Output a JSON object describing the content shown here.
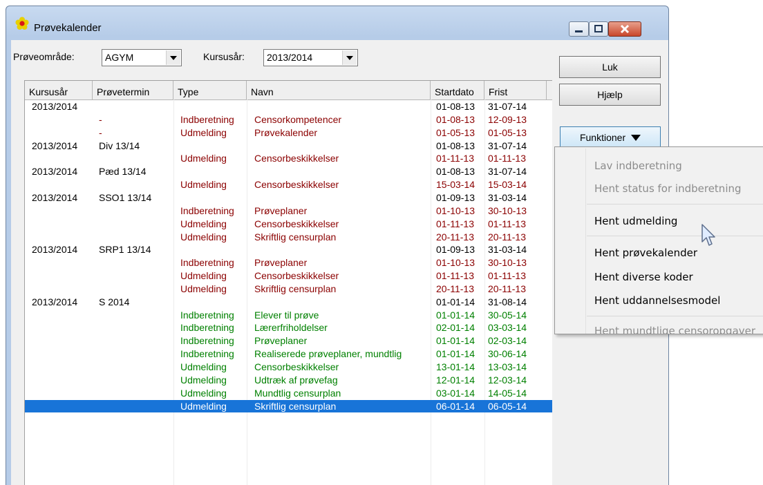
{
  "window": {
    "title": "Prøvekalender"
  },
  "filters": {
    "area_label": "Prøveområde:",
    "area_value": "AGYM",
    "year_label": "Kursusår:",
    "year_value": "2013/2014"
  },
  "buttons": {
    "close": "Luk",
    "help": "Hjælp",
    "functions": "Funktioner"
  },
  "columns": [
    "Kursusår",
    "Prøvetermin",
    "Type",
    "Navn",
    "Startdato",
    "Frist"
  ],
  "rows": [
    {
      "year": "2013/2014",
      "term": "",
      "type": "",
      "name": "",
      "start": "01-08-13",
      "frist": "31-07-14",
      "color": "#000000"
    },
    {
      "year": "",
      "term": "-",
      "type": "Indberetning",
      "name": "Censorkompetencer",
      "start": "01-08-13",
      "frist": "12-09-13",
      "color": "#8b0000"
    },
    {
      "year": "",
      "term": "-",
      "type": "Udmelding",
      "name": "Prøvekalender",
      "start": "01-05-13",
      "frist": "01-05-13",
      "color": "#8b0000"
    },
    {
      "year": "2013/2014",
      "term": "Div 13/14",
      "type": "",
      "name": "",
      "start": "01-08-13",
      "frist": "31-07-14",
      "color": "#000000"
    },
    {
      "year": "",
      "term": "",
      "type": "Udmelding",
      "name": "Censorbeskikkelser",
      "start": "01-11-13",
      "frist": "01-11-13",
      "color": "#8b0000"
    },
    {
      "year": "2013/2014",
      "term": "Pæd 13/14",
      "type": "",
      "name": "",
      "start": "01-08-13",
      "frist": "31-07-14",
      "color": "#000000"
    },
    {
      "year": "",
      "term": "",
      "type": "Udmelding",
      "name": "Censorbeskikkelser",
      "start": "15-03-14",
      "frist": "15-03-14",
      "color": "#8b0000"
    },
    {
      "year": "2013/2014",
      "term": "SSO1 13/14",
      "type": "",
      "name": "",
      "start": "01-09-13",
      "frist": "31-03-14",
      "color": "#000000"
    },
    {
      "year": "",
      "term": "",
      "type": "Indberetning",
      "name": "Prøveplaner",
      "start": "01-10-13",
      "frist": "30-10-13",
      "color": "#8b0000"
    },
    {
      "year": "",
      "term": "",
      "type": "Udmelding",
      "name": "Censorbeskikkelser",
      "start": "01-11-13",
      "frist": "01-11-13",
      "color": "#8b0000"
    },
    {
      "year": "",
      "term": "",
      "type": "Udmelding",
      "name": "Skriftlig censurplan",
      "start": "20-11-13",
      "frist": "20-11-13",
      "color": "#8b0000"
    },
    {
      "year": "2013/2014",
      "term": "SRP1 13/14",
      "type": "",
      "name": "",
      "start": "01-09-13",
      "frist": "31-03-14",
      "color": "#000000"
    },
    {
      "year": "",
      "term": "",
      "type": "Indberetning",
      "name": "Prøveplaner",
      "start": "01-10-13",
      "frist": "30-10-13",
      "color": "#8b0000"
    },
    {
      "year": "",
      "term": "",
      "type": "Udmelding",
      "name": "Censorbeskikkelser",
      "start": "01-11-13",
      "frist": "01-11-13",
      "color": "#8b0000"
    },
    {
      "year": "",
      "term": "",
      "type": "Udmelding",
      "name": "Skriftlig censurplan",
      "start": "20-11-13",
      "frist": "20-11-13",
      "color": "#8b0000"
    },
    {
      "year": "2013/2014",
      "term": "S 2014",
      "type": "",
      "name": "",
      "start": "01-01-14",
      "frist": "31-08-14",
      "color": "#000000"
    },
    {
      "year": "",
      "term": "",
      "type": "Indberetning",
      "name": "Elever til prøve",
      "start": "01-01-14",
      "frist": "30-05-14",
      "color": "#008000"
    },
    {
      "year": "",
      "term": "",
      "type": "Indberetning",
      "name": "Lærerfriholdelser",
      "start": "02-01-14",
      "frist": "03-03-14",
      "color": "#008000"
    },
    {
      "year": "",
      "term": "",
      "type": "Indberetning",
      "name": "Prøveplaner",
      "start": "01-01-14",
      "frist": "02-03-14",
      "color": "#008000"
    },
    {
      "year": "",
      "term": "",
      "type": "Indberetning",
      "name": "Realiserede prøveplaner, mundtlig",
      "start": "01-01-14",
      "frist": "30-06-14",
      "color": "#008000"
    },
    {
      "year": "",
      "term": "",
      "type": "Udmelding",
      "name": "Censorbeskikkelser",
      "start": "13-01-14",
      "frist": "13-03-14",
      "color": "#008000"
    },
    {
      "year": "",
      "term": "",
      "type": "Udmelding",
      "name": "Udtræk af prøvefag",
      "start": "12-01-14",
      "frist": "12-03-14",
      "color": "#008000"
    },
    {
      "year": "",
      "term": "",
      "type": "Udmelding",
      "name": "Mundtlig censurplan",
      "start": "03-01-14",
      "frist": "14-05-14",
      "color": "#008000"
    },
    {
      "year": "",
      "term": "",
      "type": "Udmelding",
      "name": "Skriftlig censurplan",
      "start": "06-01-14",
      "frist": "06-05-14",
      "color": "#ffffff"
    }
  ],
  "menu": {
    "items": [
      {
        "label": "Lav indberetning",
        "enabled": false
      },
      {
        "label": "Hent status for indberetning",
        "enabled": false
      },
      {
        "label": "Hent udmelding",
        "enabled": true
      },
      {
        "label": "Hent prøvekalender",
        "enabled": true
      },
      {
        "label": "Hent diverse koder",
        "enabled": true
      },
      {
        "label": "Hent uddannelsesmodel",
        "enabled": true
      },
      {
        "label": "Hent mundtlige censoropgaver",
        "enabled": false
      }
    ]
  }
}
